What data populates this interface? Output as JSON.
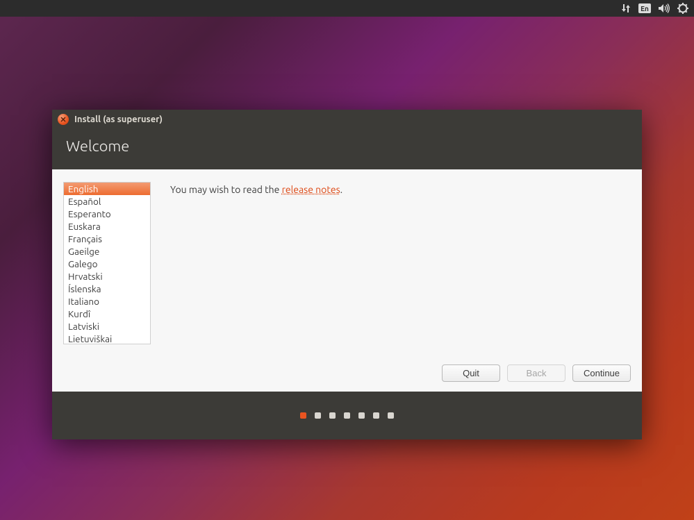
{
  "topbar": {
    "net_icon": "network-updown-icon",
    "lang_indicator": "En",
    "sound_icon": "sound-icon",
    "power_icon": "power-cog-icon"
  },
  "window": {
    "title": "Install (as superuser)",
    "heading": "Welcome"
  },
  "languages": [
    "English",
    "Español",
    "Esperanto",
    "Euskara",
    "Français",
    "Gaeilge",
    "Galego",
    "Hrvatski",
    "Íslenska",
    "Italiano",
    "Kurdî",
    "Latviski",
    "Lietuviškai"
  ],
  "selected_language_index": 0,
  "message": {
    "prefix": "You may wish to read the ",
    "link_text": "release notes",
    "suffix": "."
  },
  "buttons": {
    "quit": "Quit",
    "back": "Back",
    "continue": "Continue"
  },
  "progress": {
    "total": 7,
    "active": 0
  }
}
